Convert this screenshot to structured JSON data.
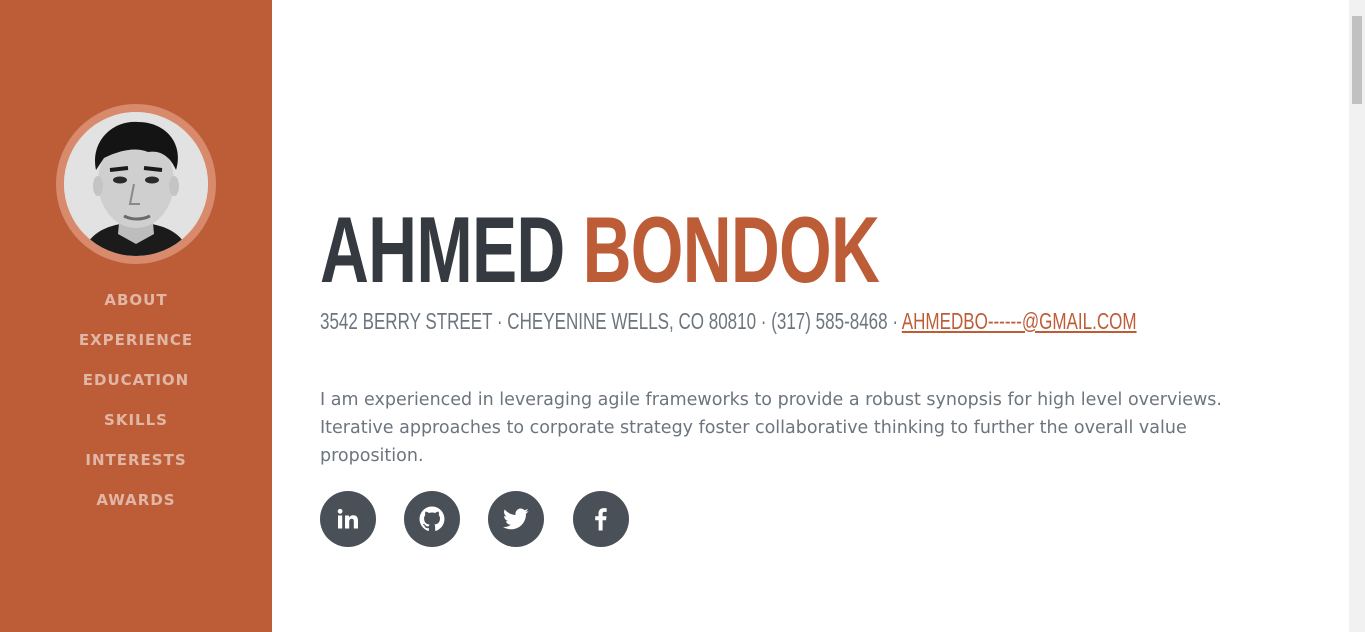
{
  "sidebar": {
    "nav": [
      "ABOUT",
      "EXPERIENCE",
      "EDUCATION",
      "SKILLS",
      "INTERESTS",
      "AWARDS"
    ]
  },
  "header": {
    "first_name": "AHMED",
    "last_name": "BONDOK",
    "address": "3542 BERRY STREET · CHEYENINE WELLS, CO 80810 · (317) 585-8468 · ",
    "email": "AHMEDBO------@GMAIL.COM"
  },
  "about": {
    "lead": "I am experienced in leveraging agile frameworks to provide a robust synopsis for high level overviews. Iterative approaches to corporate strategy foster collaborative thinking to further the overall value proposition."
  },
  "social": {
    "icons": [
      "linkedin-icon",
      "github-icon",
      "twitter-icon",
      "facebook-icon"
    ]
  },
  "colors": {
    "brand": "#bd5d38",
    "dark": "#343a40",
    "muted": "#6c757d",
    "social_bg": "#495057"
  }
}
